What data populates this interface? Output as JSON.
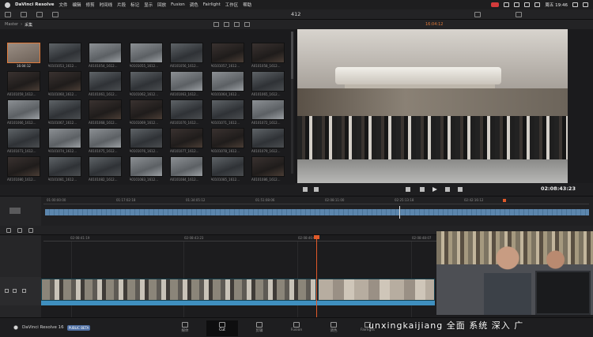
{
  "menubar": {
    "app_name": "DaVinci Resolve",
    "items": [
      "文件",
      "编辑",
      "修剪",
      "时间线",
      "片段",
      "标记",
      "显示",
      "回放",
      "Fusion",
      "调色",
      "Fairlight",
      "工作区",
      "帮助"
    ],
    "clock": "周五 19:46"
  },
  "toolbar": {
    "project_name": "412"
  },
  "media_pool": {
    "breadcrumb_root": "Master",
    "breadcrumb_current": "采集",
    "selected_clip": {
      "caption": "16:04:12"
    },
    "clips": [
      "A0101053_1612...",
      "A0101054_1612...",
      "A0101055_1612...",
      "A0101056_1612...",
      "A0101057_1612...",
      "A0101058_1612...",
      "A0101059_1612...",
      "A0101060_1612...",
      "A0101061_1612...",
      "A0101062_1612...",
      "A0101063_1612...",
      "A0101064_1612...",
      "A0101065_1612...",
      "A0101066_1612...",
      "A0101067_1612...",
      "A0101068_1612...",
      "A0101069_1612...",
      "A0101070_1612...",
      "A0101071_1612...",
      "A0101072_1612...",
      "A0101073_1612...",
      "A0101074_1612...",
      "A0101075_1612...",
      "A0101076_1612...",
      "A0101077_1612...",
      "A0101078_1612...",
      "A0101079_1612...",
      "A0101080_1612...",
      "A0101081_1612...",
      "A0101082_1612...",
      "A0101083_1612...",
      "A0101084_1612...",
      "A0101085_1612...",
      "A0101086_1612..."
    ]
  },
  "viewer": {
    "source_timecode": "16:04:12",
    "timecode": "02:08:43:23"
  },
  "timeline_upper": {
    "ruler": [
      "01:00:00:00",
      "01:17:02:18",
      "01:34:05:12",
      "01:51:08:06",
      "02:08:11:00",
      "02:25:13:18",
      "02:42:16:12"
    ]
  },
  "timeline_lower": {
    "ruler": [
      "02:08:41:19",
      "02:08:43:23",
      "02:08:46:03",
      "02:08:48:07"
    ]
  },
  "pagebar": {
    "brand": "DaVinci Resolve 16",
    "beta": "PUBLIC BETA",
    "pages": [
      "媒体",
      "Cut",
      "剪辑",
      "Fusion",
      "调色",
      "Fairlight"
    ]
  },
  "caption": "unxingkaijiang 全面 系统 深入 广"
}
